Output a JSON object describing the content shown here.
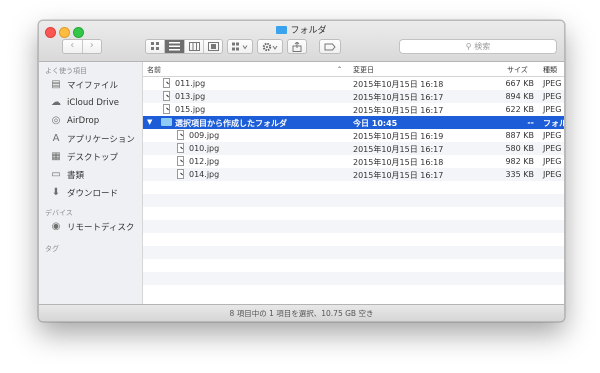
{
  "window": {
    "title": "フォルダ",
    "search_placeholder": "検索"
  },
  "sidebar": {
    "sections": [
      {
        "title": "よく使う項目",
        "items": [
          {
            "label": "マイファイル",
            "icon": "file-stack-icon"
          },
          {
            "label": "iCloud Drive",
            "icon": "cloud-icon"
          },
          {
            "label": "AirDrop",
            "icon": "airdrop-icon"
          },
          {
            "label": "アプリケーション",
            "icon": "applications-icon"
          },
          {
            "label": "デスクトップ",
            "icon": "desktop-icon"
          },
          {
            "label": "書類",
            "icon": "documents-icon"
          },
          {
            "label": "ダウンロード",
            "icon": "downloads-icon"
          }
        ]
      },
      {
        "title": "デバイス",
        "items": [
          {
            "label": "リモートディスク",
            "icon": "disc-icon"
          }
        ]
      },
      {
        "title": "タグ",
        "items": []
      }
    ]
  },
  "columns": {
    "name": "名前",
    "date": "変更日",
    "size": "サイズ",
    "kind": "種類"
  },
  "rows": [
    {
      "name": "011.jpg",
      "date": "2015年10月15日 16:18",
      "size": "667 KB",
      "kind": "JPEG"
    },
    {
      "name": "013.jpg",
      "date": "2015年10月15日 16:17",
      "size": "894 KB",
      "kind": "JPEG"
    },
    {
      "name": "015.jpg",
      "date": "2015年10月15日 16:17",
      "size": "622 KB",
      "kind": "JPEG"
    },
    {
      "name": "選択項目から作成したフォルダ",
      "date": "今日 10:45",
      "size": "--",
      "kind": "フォル"
    },
    {
      "name": "009.jpg",
      "date": "2015年10月15日 16:19",
      "size": "887 KB",
      "kind": "JPEG"
    },
    {
      "name": "010.jpg",
      "date": "2015年10月15日 16:17",
      "size": "580 KB",
      "kind": "JPEG"
    },
    {
      "name": "012.jpg",
      "date": "2015年10月15日 16:18",
      "size": "982 KB",
      "kind": "JPEG"
    },
    {
      "name": "014.jpg",
      "date": "2015年10月15日 16:17",
      "size": "335 KB",
      "kind": "JPEG"
    }
  ],
  "status": "8 項目中の 1 項目を選択、10.75 GB 空き"
}
